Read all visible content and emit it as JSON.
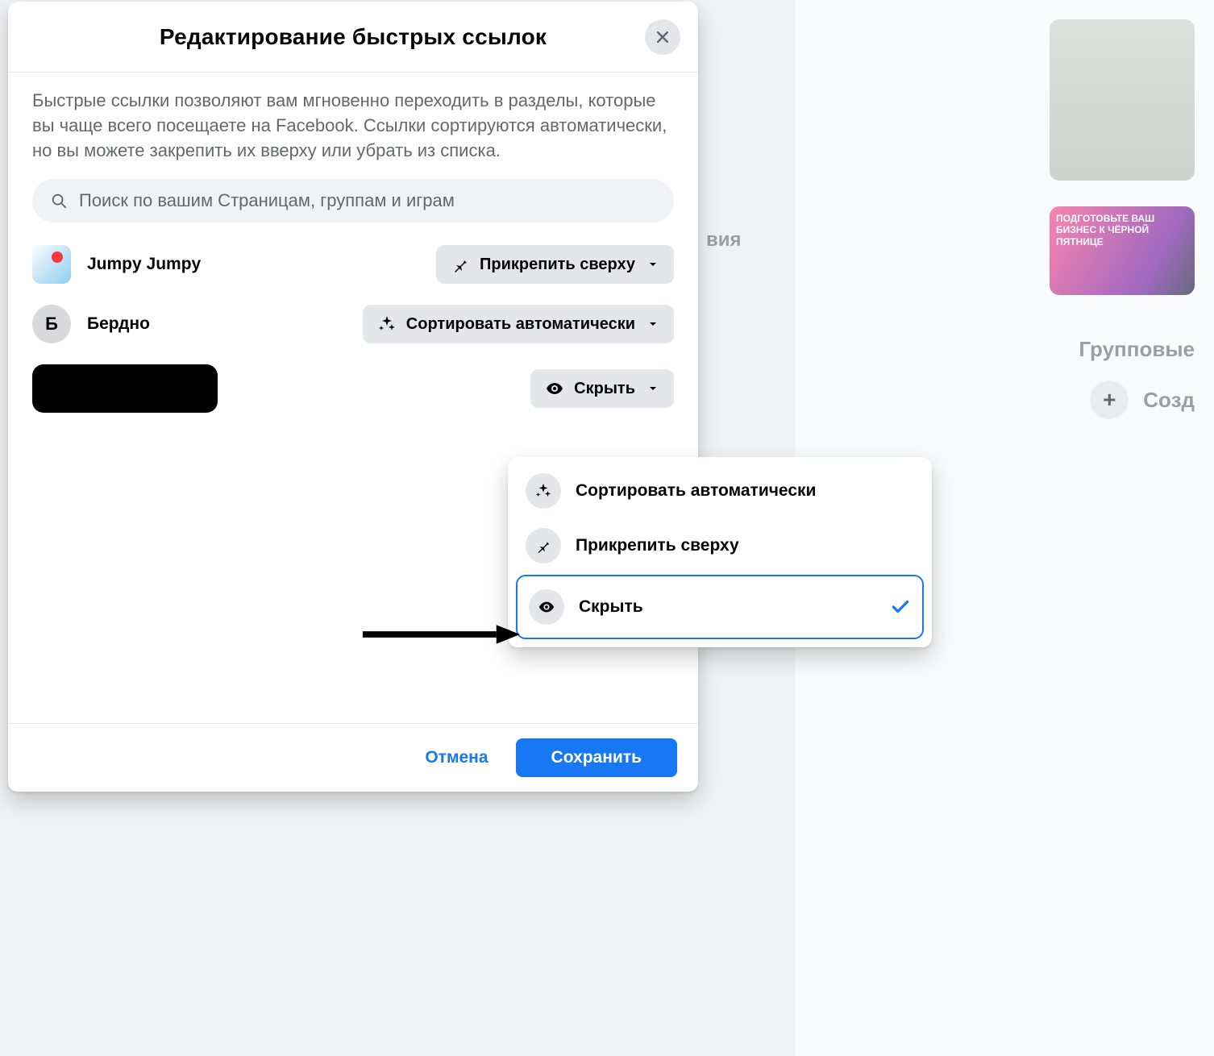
{
  "header": {
    "title": "Редактирование быстрых ссылок"
  },
  "description": "Быстрые ссылки позволяют вам мгновенно переходить в разделы, которые вы чаще всего посещаете на Facebook. Ссылки сортируются автоматически, но вы можете закрепить их вверху или убрать из списка.",
  "search": {
    "placeholder": "Поиск по вашим Страницам, группам и играм"
  },
  "items": [
    {
      "name": "Jumpy Jumpy",
      "avatar_letter": "",
      "setting_label": "Прикрепить сверху",
      "setting_icon": "pin"
    },
    {
      "name": "Бердно",
      "avatar_letter": "Б",
      "setting_label": "Сортировать автоматически",
      "setting_icon": "sparkle"
    },
    {
      "name": "",
      "avatar_letter": "",
      "setting_label": "Скрыть",
      "setting_icon": "eye"
    }
  ],
  "dropdown": {
    "options": [
      {
        "label": "Сортировать автоматически",
        "icon": "sparkle",
        "selected": false
      },
      {
        "label": "Прикрепить сверху",
        "icon": "pin",
        "selected": false
      },
      {
        "label": "Скрыть",
        "icon": "eye",
        "selected": true
      }
    ]
  },
  "footer": {
    "cancel": "Отмена",
    "save": "Сохранить"
  },
  "background": {
    "right_label": "вия",
    "group_label": "Групповые",
    "create_label": "Созд",
    "promo_text": "ПОДГОТОВЬТЕ ВАШ БИЗНЕС К ЧЁРНОЙ ПЯТНИЦЕ"
  }
}
